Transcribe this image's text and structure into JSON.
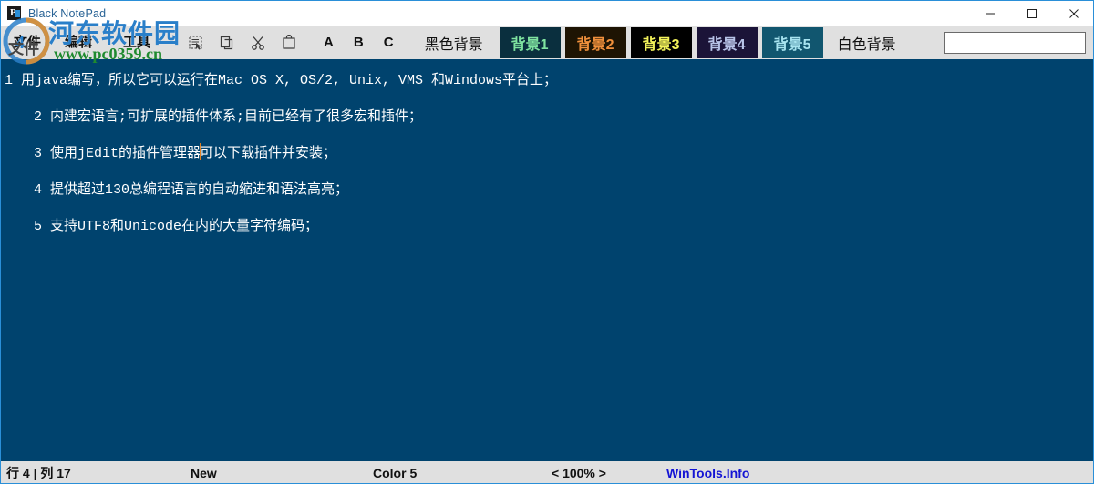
{
  "window": {
    "title": "Black NotePad",
    "app_icon": "notepad-icon",
    "minimize_label": "—",
    "maximize_label": "□",
    "close_label": "✕"
  },
  "menu": {
    "items": [
      {
        "label": "文件"
      },
      {
        "label": "编辑"
      },
      {
        "label": "工具"
      }
    ]
  },
  "toolbar": {
    "icons": [
      {
        "name": "select-all-icon"
      },
      {
        "name": "copy-icon"
      },
      {
        "name": "cut-icon"
      },
      {
        "name": "paste-icon"
      }
    ],
    "font_buttons": [
      {
        "label": "A"
      },
      {
        "label": "B"
      },
      {
        "label": "C"
      }
    ],
    "black_background_label": "黑色背景",
    "white_background_label": "白色背景",
    "background_buttons": [
      {
        "label": "背景1",
        "bg": "#0a2f3e",
        "fg": "#7fe3a0"
      },
      {
        "label": "背景2",
        "bg": "#1e1403",
        "fg": "#f0903c"
      },
      {
        "label": "背景3",
        "bg": "#000000",
        "fg": "#f2f25a"
      },
      {
        "label": "背景4",
        "bg": "#1b1438",
        "fg": "#b8c4e8"
      },
      {
        "label": "背景5",
        "bg": "#11566f",
        "fg": "#a8e4f0"
      }
    ],
    "search": {
      "value": "",
      "placeholder": ""
    }
  },
  "editor": {
    "background_color": "#00436e",
    "text_color": "#ffffff",
    "lines": [
      {
        "indent": false,
        "before_caret": "1 用java编写，所以它可以运行在Mac OS X, OS/2, Unix, VMS 和Windows平台上；",
        "after_caret": "",
        "caret": false
      },
      {
        "indent": true,
        "before_caret": "2 内建宏语言;可扩展的插件体系;目前已经有了很多宏和插件；",
        "after_caret": "",
        "caret": false
      },
      {
        "indent": true,
        "before_caret": "3 使用jEdit的插件管理器",
        "after_caret": "可以下载插件并安装；",
        "caret": true
      },
      {
        "indent": true,
        "before_caret": "4 提供超过130总编程语言的自动缩进和语法高亮；",
        "after_caret": "",
        "caret": false
      },
      {
        "indent": true,
        "before_caret": "5 支持UTF8和Unicode在内的大量字符编码；",
        "after_caret": "",
        "caret": false
      }
    ]
  },
  "statusbar": {
    "position": "行 4 | 列 17",
    "filename": "New",
    "color": "Color 5",
    "zoom": "< 100% >",
    "brand": "WinTools.Info",
    "brand_color": "#1414d4"
  },
  "watermark": {
    "site_name": "河东软件园",
    "url": "www.pc0359.cn",
    "logo_text": "文件"
  }
}
